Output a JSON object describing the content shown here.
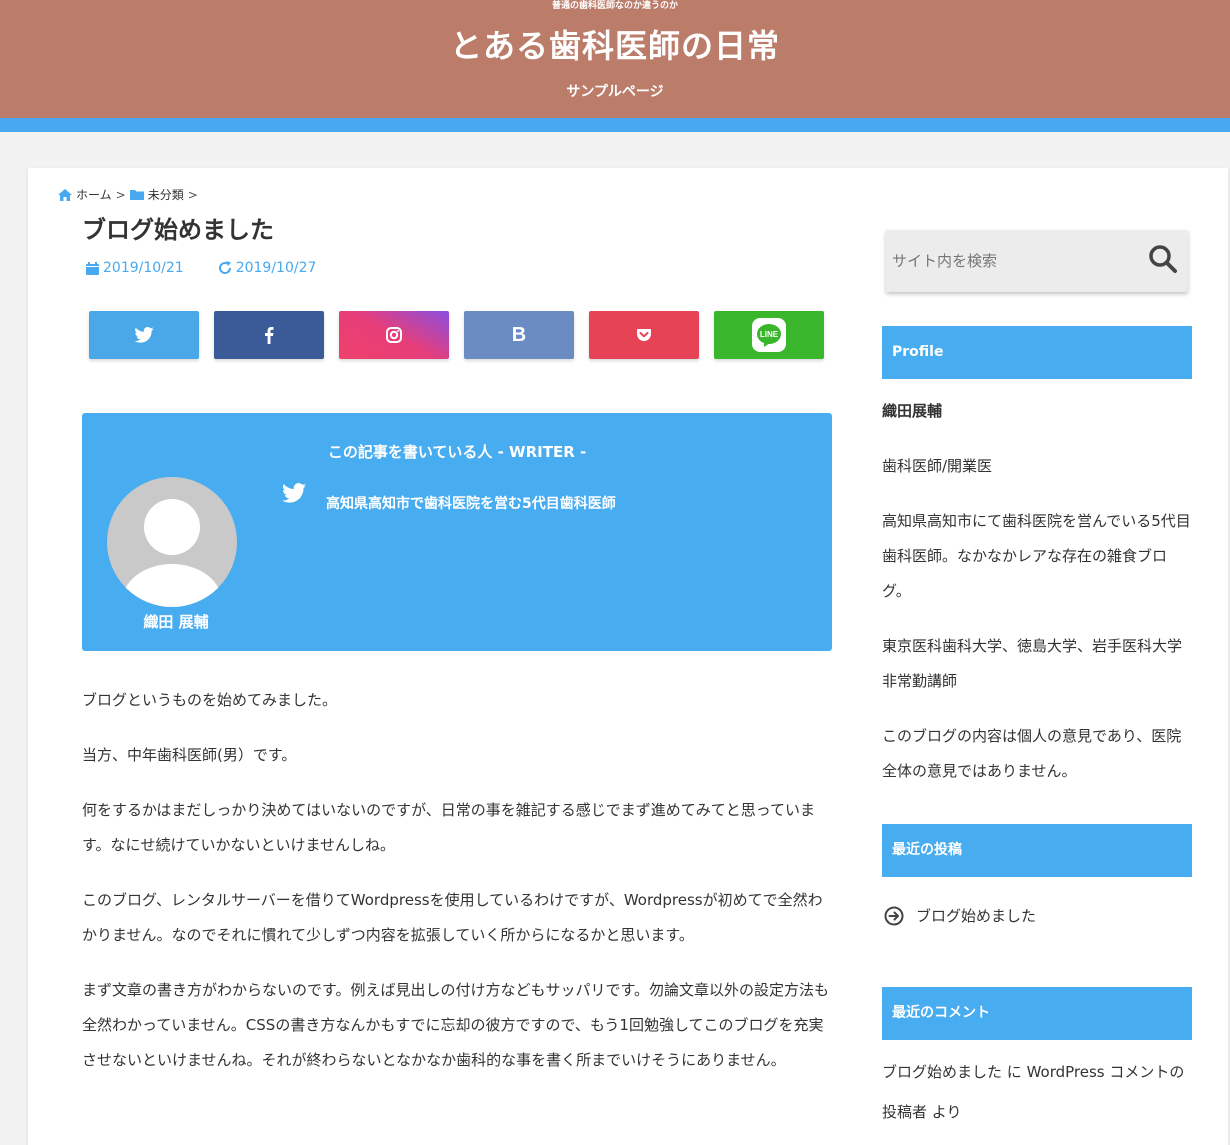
{
  "header": {
    "tagline": "普通の歯科医師なのか違うのか",
    "site_title": "とある歯科医師の日常",
    "nav_sample": "サンプルページ"
  },
  "breadcrumb": {
    "home": "ホーム",
    "category": "未分類",
    "sep": ">"
  },
  "post": {
    "title": "ブログ始めました",
    "published": "2019/10/21",
    "updated": "2019/10/27"
  },
  "share": {
    "hatena_label": "B",
    "line_label": "LINE",
    "colors": {
      "twitter": "#4aa8e8",
      "facebook": "#3b5a98",
      "instagram": "#e63e7a",
      "hatena": "#6a8cc2",
      "pocket": "#e64356",
      "line": "#3ab62c"
    }
  },
  "writer": {
    "heading": "この記事を書いている人 - WRITER -",
    "name": "織田 展輔",
    "description": "高知県高知市で歯科医院を営む5代目歯科医師"
  },
  "article": {
    "paragraphs": [
      "ブログというものを始めてみました。",
      "当方、中年歯科医師(男）です。",
      "何をするかはまだしっかり決めてはいないのですが、日常の事を雑記する感じでまず進めてみてと思っています。なにせ続けていかないといけませんしね。",
      "このブログ、レンタルサーバーを借りてWordpressを使用しているわけですが、Wordpressが初めてで全然わかりません。なのでそれに慣れて少しずつ内容を拡張していく所からになるかと思います。",
      "まず文章の書き方がわからないのです。例えば見出しの付け方などもサッパリです。勿論文章以外の設定方法も全然わかっていません。CSSの書き方なんかもすでに忘却の彼方ですので、もう1回勉強してこのブログを充実させないといけませんね。それが終わらないとなかなか歯科的な事を書く所までいけそうにありません。"
    ]
  },
  "sidebar": {
    "search_placeholder": "サイト内を検索",
    "profile": {
      "title": "Profile",
      "name": "織田展輔",
      "lines": [
        "歯科医師/開業医",
        "高知県高知市にて歯科医院を営んでいる5代目歯科医師。なかなかレアな存在の雑食ブログ。",
        "東京医科歯科大学、徳島大学、岩手医科大学非常勤講師",
        "このブログの内容は個人の意見であり、医院全体の意見ではありません。"
      ]
    },
    "recent_posts": {
      "title": "最近の投稿",
      "items": [
        "ブログ始めました"
      ]
    },
    "recent_comments": {
      "title": "最近のコメント",
      "post": "ブログ始めました",
      "connector": " に ",
      "author": "WordPress コメントの投稿者",
      "suffix": " より"
    }
  }
}
